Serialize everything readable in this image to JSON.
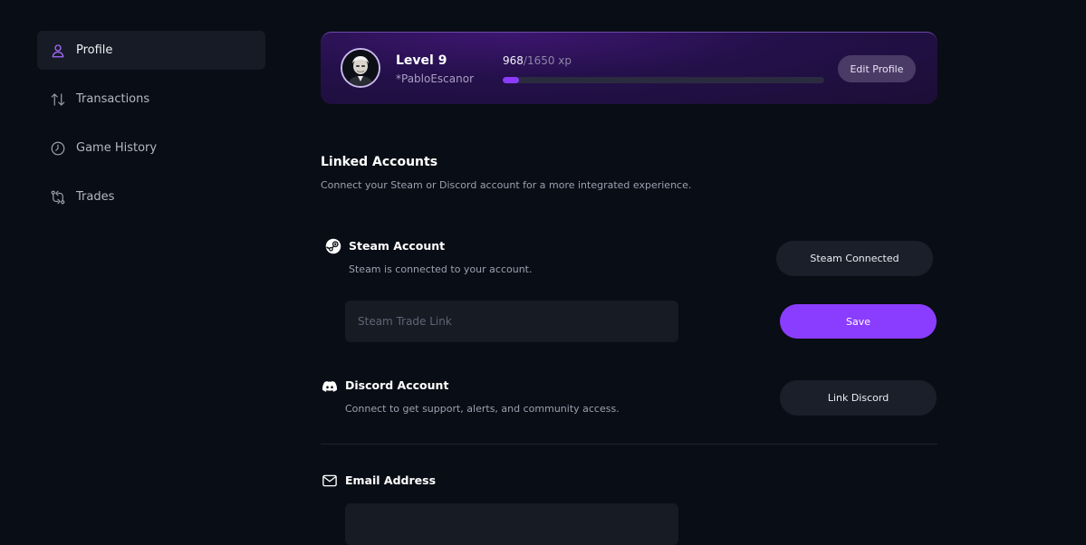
{
  "sidebar": {
    "items": [
      {
        "label": "Profile",
        "icon": "user-icon",
        "active": true
      },
      {
        "label": "Transactions",
        "icon": "arrows-up-down-icon",
        "active": false
      },
      {
        "label": "Game History",
        "icon": "clock-icon",
        "active": false
      },
      {
        "label": "Trades",
        "icon": "trade-arrows-icon",
        "active": false
      }
    ]
  },
  "profile": {
    "level": "Level 9",
    "username": "*PabloEscanor",
    "xp_current": "968",
    "xp_max": "/1650 xp",
    "xp_progress": 0.05,
    "edit_label": "Edit Profile",
    "accent": "#8b3bff"
  },
  "linked": {
    "title": "Linked Accounts",
    "subtitle": "Connect your Steam or Discord account for a more integrated experience.",
    "steam": {
      "title": "Steam Account",
      "subtitle": "Steam is connected to your account.",
      "status_label": "Steam Connected",
      "trade_link_placeholder": "Steam Trade Link",
      "save_label": "Save",
      "icon": "steam-icon"
    },
    "discord": {
      "title": "Discord Account",
      "subtitle": "Connect to get support, alerts, and community access.",
      "link_label": "Link Discord",
      "icon": "discord-icon"
    },
    "email": {
      "title": "Email Address",
      "icon": "mail-icon"
    }
  }
}
